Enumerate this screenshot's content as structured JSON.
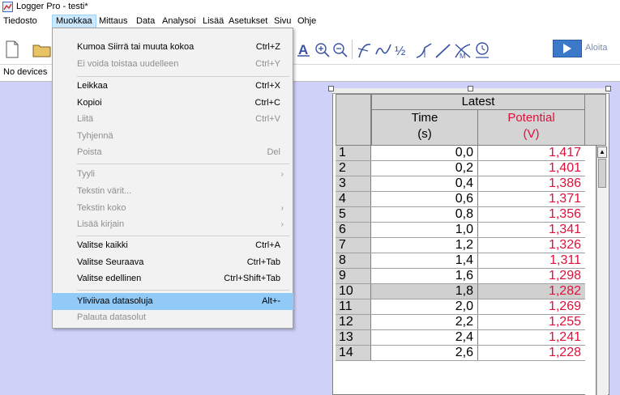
{
  "window": {
    "title": "Logger Pro - testi*"
  },
  "menubar": {
    "items": [
      "Tiedosto",
      "Muokkaa",
      "Mittaus",
      "Data",
      "Analysoi",
      "Lisää",
      "Asetukset",
      "Sivu",
      "Ohje"
    ],
    "active": "Muokkaa"
  },
  "toolbar": {
    "collect_label": "Aloita",
    "icons": [
      "new-file-icon",
      "open-folder-icon",
      "autoscale-icon",
      "zoom-in-icon",
      "zoom-out-icon",
      "examine-icon",
      "tangent-icon",
      "integral-icon",
      "stats-icon",
      "linear-fit-icon",
      "curve-fit-icon",
      "model-icon",
      "play-icon"
    ]
  },
  "status": {
    "device": "No devices"
  },
  "edit_menu": {
    "items": [
      {
        "label": "Kumoa Siirrä tai muuta kokoa",
        "shortcut": "Ctrl+Z",
        "enabled": true
      },
      {
        "label": "Ei voida toistaa uudelleen",
        "shortcut": "Ctrl+Y",
        "enabled": false
      },
      {
        "label": "Leikkaa",
        "shortcut": "Ctrl+X",
        "enabled": true
      },
      {
        "label": "Kopioi",
        "shortcut": "Ctrl+C",
        "enabled": true
      },
      {
        "label": "Liitä",
        "shortcut": "Ctrl+V",
        "enabled": false
      },
      {
        "label": "Tyhjennä",
        "shortcut": "",
        "enabled": false
      },
      {
        "label": "Poista",
        "shortcut": "Del",
        "enabled": false
      },
      {
        "label": "Tyyli",
        "shortcut": "",
        "enabled": false,
        "submenu": true
      },
      {
        "label": "Tekstin värit...",
        "shortcut": "",
        "enabled": false
      },
      {
        "label": "Tekstin koko",
        "shortcut": "",
        "enabled": false,
        "submenu": true
      },
      {
        "label": "Lisää kirjain",
        "shortcut": "",
        "enabled": false,
        "submenu": true
      },
      {
        "label": "Valitse kaikki",
        "shortcut": "Ctrl+A",
        "enabled": true
      },
      {
        "label": "Valitse Seuraava",
        "shortcut": "Ctrl+Tab",
        "enabled": true
      },
      {
        "label": "Valitse edellinen",
        "shortcut": "Ctrl+Shift+Tab",
        "enabled": true
      },
      {
        "label": "Yliviivaa datasoluja",
        "shortcut": "Alt+-",
        "enabled": true,
        "highlighted": true
      },
      {
        "label": "Palauta datasolut",
        "shortcut": "",
        "enabled": false
      }
    ],
    "submenu_arrow": "›"
  },
  "table": {
    "dataset": "Latest",
    "columns": [
      {
        "name": "Time",
        "unit": "(s)"
      },
      {
        "name": "Potential",
        "unit": "(V)"
      }
    ],
    "rows": [
      {
        "n": "1",
        "time": "0,0",
        "potential": "1,417"
      },
      {
        "n": "2",
        "time": "0,2",
        "potential": "1,401"
      },
      {
        "n": "3",
        "time": "0,4",
        "potential": "1,386"
      },
      {
        "n": "4",
        "time": "0,6",
        "potential": "1,371"
      },
      {
        "n": "5",
        "time": "0,8",
        "potential": "1,356"
      },
      {
        "n": "6",
        "time": "1,0",
        "potential": "1,341"
      },
      {
        "n": "7",
        "time": "1,2",
        "potential": "1,326"
      },
      {
        "n": "8",
        "time": "1,4",
        "potential": "1,311"
      },
      {
        "n": "9",
        "time": "1,6",
        "potential": "1,298"
      },
      {
        "n": "10",
        "time": "1,8",
        "potential": "1,282"
      },
      {
        "n": "11",
        "time": "2,0",
        "potential": "1,269"
      },
      {
        "n": "12",
        "time": "2,2",
        "potential": "1,255"
      },
      {
        "n": "13",
        "time": "2,4",
        "potential": "1,241"
      },
      {
        "n": "14",
        "time": "2,6",
        "potential": "1,228"
      }
    ],
    "selected_row": "10"
  },
  "colors": {
    "work_area": "#cfd1f9",
    "potential": "#e0103a",
    "menu_highlight": "#91c9f7",
    "active_menu": "#cce8ff"
  }
}
